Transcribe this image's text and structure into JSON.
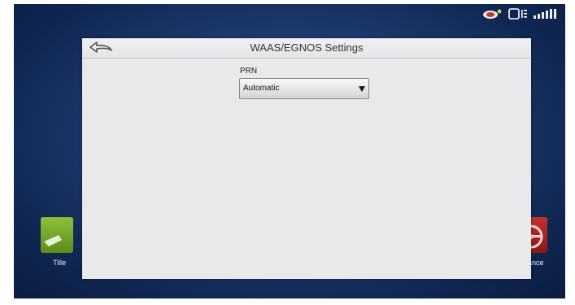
{
  "dialog": {
    "title": "WAAS/EGNOS Settings",
    "back_icon": "back-arrow-icon"
  },
  "prn": {
    "label": "PRN",
    "selected_value": "Automatic"
  },
  "background_tiles": {
    "left_label": "Tille",
    "right_label": "dance",
    "left_color": "#7aab2c",
    "right_color": "#b72a22"
  },
  "status_icons": [
    "gps-satellite-icon",
    "display-icon",
    "cellular-signal-icon"
  ],
  "colors": {
    "screen_background": "#1d3a6d",
    "dialog_background": "#e9e9ec"
  }
}
